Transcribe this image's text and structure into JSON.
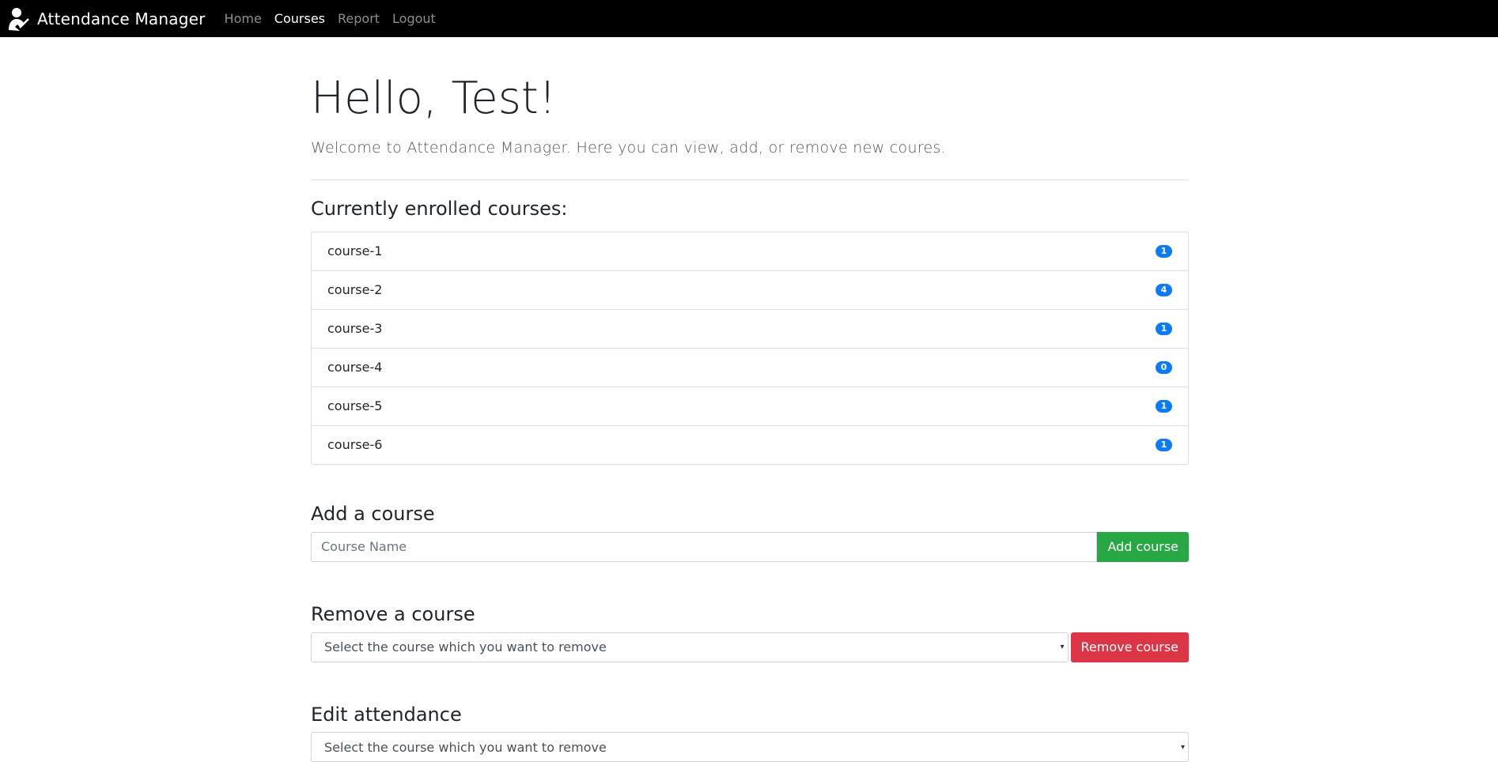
{
  "navbar": {
    "brand": "Attendance Manager",
    "links": [
      {
        "label": "Home"
      },
      {
        "label": "Courses"
      },
      {
        "label": "Report"
      },
      {
        "label": "Logout"
      }
    ]
  },
  "hero": {
    "title": "Hello, Test!",
    "lead": "Welcome to Attendance Manager. Here you can view, add, or remove new coures."
  },
  "enrolled": {
    "heading": "Currently enrolled courses:",
    "courses": [
      {
        "name": "course-1",
        "count": "1"
      },
      {
        "name": "course-2",
        "count": "4"
      },
      {
        "name": "course-3",
        "count": "1"
      },
      {
        "name": "course-4",
        "count": "0"
      },
      {
        "name": "course-5",
        "count": "1"
      },
      {
        "name": "course-6",
        "count": "1"
      }
    ],
    "badge_color": "#0d7bf7"
  },
  "add_course": {
    "heading": "Add a course",
    "placeholder": "Course Name",
    "button": "Add course",
    "button_color": "#28a745"
  },
  "remove_course": {
    "heading": "Remove a course",
    "select_value": "Select the course which you want to remove",
    "button": "Remove course",
    "button_color": "#dc3545"
  },
  "edit_attendance": {
    "heading": "Edit attendance",
    "select_value": "Select the course which you want to remove"
  }
}
